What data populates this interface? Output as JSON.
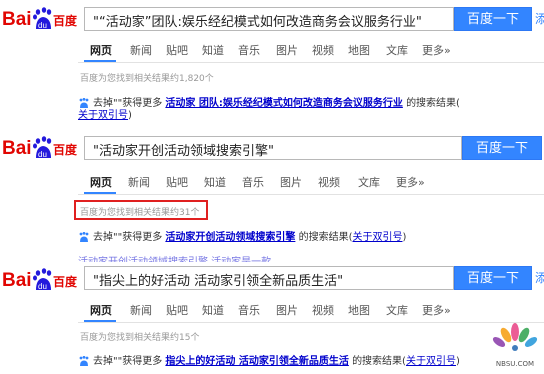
{
  "logo": {
    "text_bai": "Bai",
    "text_du": "du",
    "text_cn": "百度"
  },
  "panels": [
    {
      "query": "\"“活动家”团队:娱乐经纪模式如何改造商务会议服务行业\"",
      "search_button": "百度一下",
      "tabs": [
        "网页",
        "新闻",
        "贴吧",
        "知道",
        "音乐",
        "图片",
        "视频",
        "地图",
        "文库",
        "更多»"
      ],
      "result_count": "百度为您找到相关结果约1,820个",
      "hint_prefix": "去掉\"\"获得更多",
      "hint_link": "活动家 团队:娱乐经纪模式如何改造商务会议服务行业",
      "hint_suffix": "的搜索结果(",
      "hint_help_link": "关于双引号",
      "hint_close": ")"
    },
    {
      "query": "\"活动家开创活动领域搜索引擎\"",
      "search_button": "百度一下",
      "tabs": [
        "网页",
        "新闻",
        "贴吧",
        "知道",
        "音乐",
        "图片",
        "视频",
        "文库",
        "更多»"
      ],
      "result_count": "百度为您找到相关结果约31个",
      "hint_prefix": "去掉\"\"获得更多",
      "hint_link": "活动家开创活动领域搜索引擎",
      "hint_suffix": "的搜索结果(",
      "hint_help_link": "关于双引号",
      "hint_close": ")"
    },
    {
      "query": "\"指尖上的好活动 活动家引领全新品质生活\"",
      "search_button": "百度一下",
      "tabs": [
        "网页",
        "新闻",
        "贴吧",
        "知道",
        "音乐",
        "图片",
        "视频",
        "地图",
        "文库",
        "更多»"
      ],
      "result_count": "百度为您找到相关结果约15个",
      "hint_prefix": "去掉\"\"获得更多",
      "hint_link": "指尖上的好活动 活动家引领全新品质生活",
      "hint_suffix": "的搜索结果(",
      "hint_help_link": "关于双引号",
      "hint_close": ")"
    }
  ],
  "edge_text": "添",
  "overlap_text": "活动家开创活动领域搜索引擎 活动家是一款...",
  "watermark": "NBSU.COM",
  "colors": {
    "accent": "#3385ff",
    "logo_red": "#e10602",
    "link": "#0000cc",
    "highlight_box": "#e02020"
  }
}
